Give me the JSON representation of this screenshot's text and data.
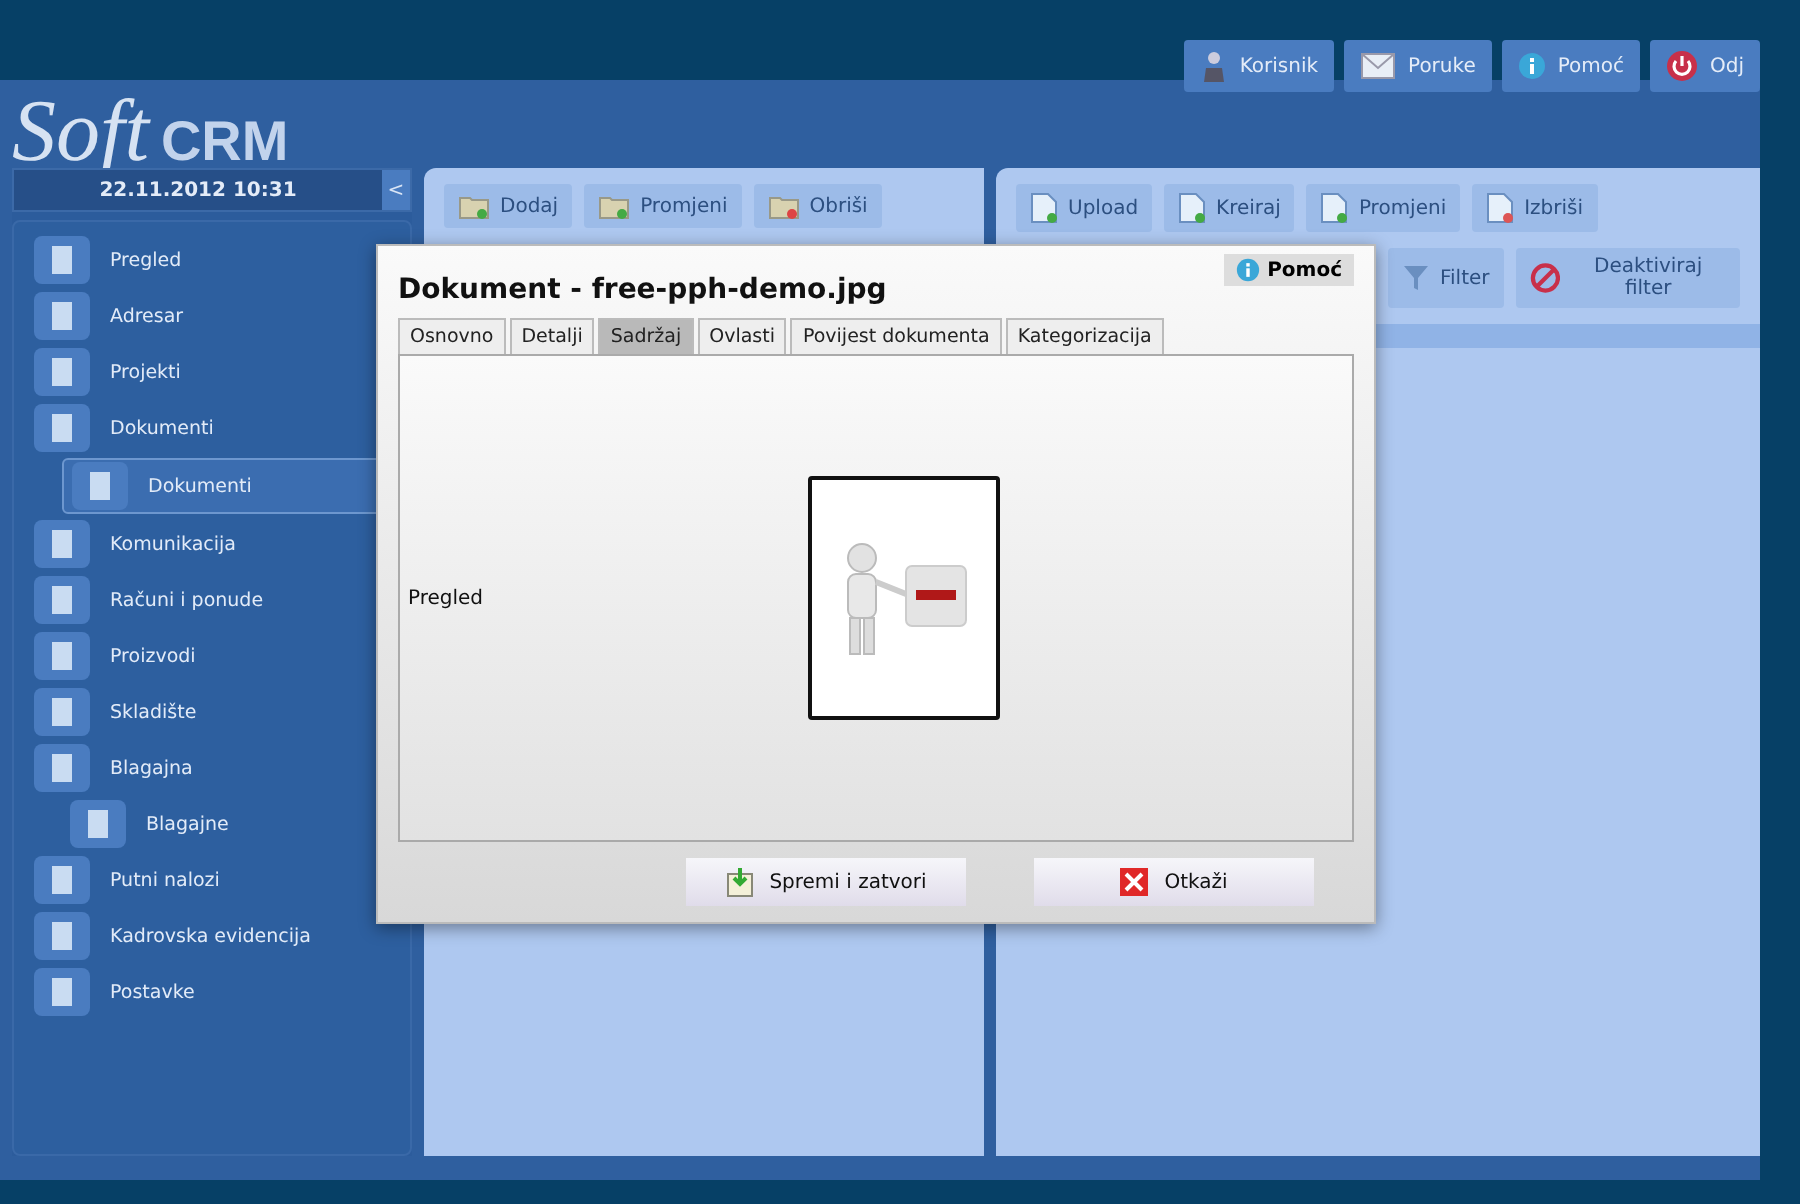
{
  "logo": {
    "script": "Soft",
    "bold": "CRM"
  },
  "top_buttons": [
    {
      "kind": "user",
      "label": "Korisnik"
    },
    {
      "kind": "mail",
      "label": "Poruke"
    },
    {
      "kind": "info",
      "label": "Pomoć"
    },
    {
      "kind": "power",
      "label": "Odj"
    }
  ],
  "sidebar": {
    "datetime": "22.11.2012 10:31",
    "collapse": "<",
    "items": [
      {
        "label": "Pregled",
        "selected": false
      },
      {
        "label": "Adresar",
        "selected": false
      },
      {
        "label": "Projekti",
        "selected": false
      },
      {
        "label": "Dokumenti",
        "selected": false,
        "children": [
          {
            "label": "Dokumenti",
            "selected": true
          }
        ]
      },
      {
        "label": "Komunikacija",
        "selected": false
      },
      {
        "label": "Računi i ponude",
        "selected": false
      },
      {
        "label": "Proizvodi",
        "selected": false
      },
      {
        "label": "Skladište",
        "selected": false
      },
      {
        "label": "Blagajna",
        "selected": false,
        "children": [
          {
            "label": "Blagajne",
            "selected": false
          }
        ]
      },
      {
        "label": "Putni nalozi",
        "selected": false
      },
      {
        "label": "Kadrovska evidencija",
        "selected": false
      },
      {
        "label": "Postavke",
        "selected": false
      }
    ]
  },
  "left_toolbar": [
    "Dodaj",
    "Promjeni",
    "Obriši"
  ],
  "right_toolbar": [
    "Upload",
    "Kreiraj",
    "Promjeni",
    "Izbriši"
  ],
  "filter_bar": [
    {
      "kind": "filter",
      "label": "Filter"
    },
    {
      "kind": "clear",
      "label": "Deaktiviraj filter"
    }
  ],
  "dialog": {
    "title": "Dokument - free-pph-demo.jpg",
    "help": "Pomoć",
    "tabs": [
      {
        "label": "Osnovno",
        "selected": false
      },
      {
        "label": "Detalji",
        "selected": false
      },
      {
        "label": "Sadržaj",
        "selected": true
      },
      {
        "label": "Ovlasti",
        "selected": false
      },
      {
        "label": "Povijest dokumenta",
        "selected": false
      },
      {
        "label": "Kategorizacija",
        "selected": false
      }
    ],
    "field_label": "Pregled",
    "buttons": [
      {
        "kind": "save",
        "label": "Spremi i zatvori"
      },
      {
        "kind": "cancel",
        "label": "Otkaži"
      }
    ]
  }
}
